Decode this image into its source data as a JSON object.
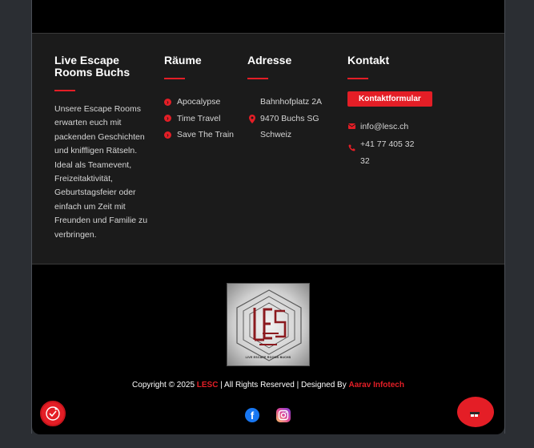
{
  "about": {
    "title": "Live Escape Rooms Buchs",
    "text": "Unsere Escape Rooms erwarten euch mit packenden Geschichten und kniffligen Rätseln. Ideal als Teamevent, Freizeitaktivität, Geburtstagsfeier oder einfach um Zeit mit Freunden und Familie zu verbringen."
  },
  "rooms": {
    "title": "Räume",
    "items": [
      {
        "label": "Apocalypse"
      },
      {
        "label": "Time Travel"
      },
      {
        "label": "Save The Train"
      }
    ]
  },
  "address": {
    "title": "Adresse",
    "street": "Bahnhofplatz 2A",
    "city": "9470 Buchs SG",
    "country": "Schweiz"
  },
  "contact": {
    "title": "Kontakt",
    "button_label": "Kontaktformular",
    "email": "info@lesc.ch",
    "phone": "+41 77 405 32 32"
  },
  "logo": {
    "text": "LESC",
    "caption": "LIVE ESCAPE ROOMS BUCHS"
  },
  "copyright": {
    "prefix": "Copyright © 2025 ",
    "brand": "LESC",
    "middle": " | All Rights Reserved | Designed By ",
    "designer": "Aarav Infotech"
  },
  "colors": {
    "accent": "#e41e26",
    "footer_bg": "#1b1b1b",
    "page_bg": "#000000"
  },
  "icons": {
    "social": [
      "facebook-icon",
      "instagram-icon"
    ],
    "fab_left": "accessibility-icon",
    "fab_right": "chat-icon"
  }
}
